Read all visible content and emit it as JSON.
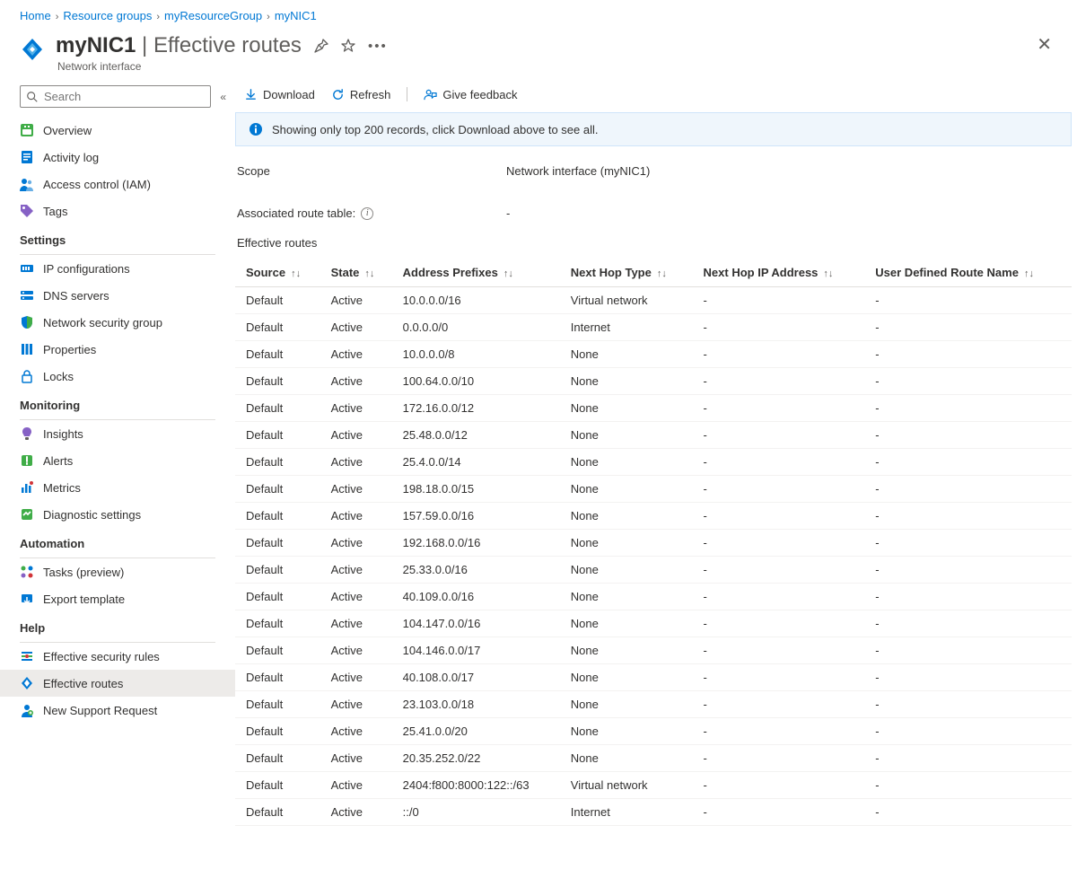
{
  "breadcrumb": [
    "Home",
    "Resource groups",
    "myResourceGroup",
    "myNIC1"
  ],
  "header": {
    "resource": "myNIC1",
    "page": "Effective routes",
    "subtitle": "Network interface"
  },
  "search": {
    "placeholder": "Search"
  },
  "sidebar": {
    "top": [
      {
        "id": "overview",
        "label": "Overview",
        "icon": "overview"
      },
      {
        "id": "activity",
        "label": "Activity log",
        "icon": "activity"
      },
      {
        "id": "iam",
        "label": "Access control (IAM)",
        "icon": "iam"
      },
      {
        "id": "tags",
        "label": "Tags",
        "icon": "tags"
      }
    ],
    "sections": [
      {
        "title": "Settings",
        "items": [
          {
            "id": "ipconfig",
            "label": "IP configurations",
            "icon": "ipconfig"
          },
          {
            "id": "dns",
            "label": "DNS servers",
            "icon": "dns"
          },
          {
            "id": "nsg",
            "label": "Network security group",
            "icon": "nsg"
          },
          {
            "id": "props",
            "label": "Properties",
            "icon": "props"
          },
          {
            "id": "locks",
            "label": "Locks",
            "icon": "locks"
          }
        ]
      },
      {
        "title": "Monitoring",
        "items": [
          {
            "id": "insights",
            "label": "Insights",
            "icon": "insights"
          },
          {
            "id": "alerts",
            "label": "Alerts",
            "icon": "alerts"
          },
          {
            "id": "metrics",
            "label": "Metrics",
            "icon": "metrics"
          },
          {
            "id": "diag",
            "label": "Diagnostic settings",
            "icon": "diag"
          }
        ]
      },
      {
        "title": "Automation",
        "items": [
          {
            "id": "tasks",
            "label": "Tasks (preview)",
            "icon": "tasks"
          },
          {
            "id": "export",
            "label": "Export template",
            "icon": "export"
          }
        ]
      },
      {
        "title": "Help",
        "items": [
          {
            "id": "effsec",
            "label": "Effective security rules",
            "icon": "effsec"
          },
          {
            "id": "effroutes",
            "label": "Effective routes",
            "icon": "effroutes",
            "selected": true
          },
          {
            "id": "support",
            "label": "New Support Request",
            "icon": "support"
          }
        ]
      }
    ]
  },
  "toolbar": {
    "download": "Download",
    "refresh": "Refresh",
    "feedback": "Give feedback"
  },
  "banner": "Showing only top 200 records, click Download above to see all.",
  "kv": {
    "scope_label": "Scope",
    "scope_value": "Network interface (myNIC1)",
    "assoc_label": "Associated route table:",
    "assoc_value": "-"
  },
  "table": {
    "title": "Effective routes",
    "columns": [
      "Source",
      "State",
      "Address Prefixes",
      "Next Hop Type",
      "Next Hop IP Address",
      "User Defined Route Name"
    ],
    "rows": [
      [
        "Default",
        "Active",
        "10.0.0.0/16",
        "Virtual network",
        "-",
        "-"
      ],
      [
        "Default",
        "Active",
        "0.0.0.0/0",
        "Internet",
        "-",
        "-"
      ],
      [
        "Default",
        "Active",
        "10.0.0.0/8",
        "None",
        "-",
        "-"
      ],
      [
        "Default",
        "Active",
        "100.64.0.0/10",
        "None",
        "-",
        "-"
      ],
      [
        "Default",
        "Active",
        "172.16.0.0/12",
        "None",
        "-",
        "-"
      ],
      [
        "Default",
        "Active",
        "25.48.0.0/12",
        "None",
        "-",
        "-"
      ],
      [
        "Default",
        "Active",
        "25.4.0.0/14",
        "None",
        "-",
        "-"
      ],
      [
        "Default",
        "Active",
        "198.18.0.0/15",
        "None",
        "-",
        "-"
      ],
      [
        "Default",
        "Active",
        "157.59.0.0/16",
        "None",
        "-",
        "-"
      ],
      [
        "Default",
        "Active",
        "192.168.0.0/16",
        "None",
        "-",
        "-"
      ],
      [
        "Default",
        "Active",
        "25.33.0.0/16",
        "None",
        "-",
        "-"
      ],
      [
        "Default",
        "Active",
        "40.109.0.0/16",
        "None",
        "-",
        "-"
      ],
      [
        "Default",
        "Active",
        "104.147.0.0/16",
        "None",
        "-",
        "-"
      ],
      [
        "Default",
        "Active",
        "104.146.0.0/17",
        "None",
        "-",
        "-"
      ],
      [
        "Default",
        "Active",
        "40.108.0.0/17",
        "None",
        "-",
        "-"
      ],
      [
        "Default",
        "Active",
        "23.103.0.0/18",
        "None",
        "-",
        "-"
      ],
      [
        "Default",
        "Active",
        "25.41.0.0/20",
        "None",
        "-",
        "-"
      ],
      [
        "Default",
        "Active",
        "20.35.252.0/22",
        "None",
        "-",
        "-"
      ],
      [
        "Default",
        "Active",
        "2404:f800:8000:122::/63",
        "Virtual network",
        "-",
        "-"
      ],
      [
        "Default",
        "Active",
        "::/0",
        "Internet",
        "-",
        "-"
      ]
    ]
  },
  "icons": {
    "overview": "<svg viewBox='0 0 16 16'><rect x='1' y='1' width='14' height='14' rx='2' fill='#40ad48'/><rect x='5' y='3' width='2' height='2' fill='#fff'/><rect x='9' y='3' width='2' height='2' fill='#fff'/><rect x='3' y='7' width='10' height='6' rx='1' fill='#fff'/></svg>",
    "activity": "<svg viewBox='0 0 16 16'><rect x='2' y='1' width='12' height='14' rx='1' fill='#0078d4'/><rect x='4' y='4' width='8' height='1.5' fill='#fff'/><rect x='4' y='7' width='8' height='1.5' fill='#fff'/><rect x='4' y='10' width='5' height='1.5' fill='#fff'/></svg>",
    "iam": "<svg viewBox='0 0 16 16'><circle cx='5' cy='5' r='3' fill='#0078d4'/><path d='M0 16 C0 11 4 10 5 10 C6 10 10 11 10 16 Z' fill='#0078d4'/><circle cx='11' cy='6' r='2.2' fill='#69afe5'/><path d='M7 16 C7 12 10 11.5 11 11.5 C12 11.5 15 12 15 16 Z' fill='#69afe5'/></svg>",
    "tags": "<svg viewBox='0 0 16 16'><path d='M1 1 L8 1 L15 8 L8 15 L1 8 Z' fill='#8661c5'/><circle cx='4.5' cy='4.5' r='1.5' fill='#fff'/></svg>",
    "ipconfig": "<svg viewBox='0 0 16 16'><rect x='1' y='4' width='14' height='8' rx='1' fill='#0078d4'/><rect x='3' y='6' width='2' height='4' fill='#fff'/><rect x='6' y='6' width='2' height='4' fill='#fff'/><rect x='9' y='6' width='2' height='4' fill='#fff'/></svg>",
    "dns": "<svg viewBox='0 0 16 16'><rect x='1' y='3' width='14' height='4' rx='1' fill='#0078d4'/><rect x='1' y='9' width='14' height='4' rx='1' fill='#0078d4'/><circle cx='4' cy='5' r='1' fill='#fff'/><circle cx='4' cy='11' r='1' fill='#fff'/></svg>",
    "nsg": "<svg viewBox='0 0 16 16'><path d='M8 1 L14 3 L14 8 C14 12 11 15 8 15 C5 15 2 12 2 8 L2 3 Z' fill='#0078d4'/><path d='M8 1 L14 3 L14 8 C14 12 11 15 8 15 Z' fill='#40ad48'/></svg>",
    "props": "<svg viewBox='0 0 16 16'><rect x='2' y='2' width='3' height='12' fill='#0078d4'/><rect x='6.5' y='2' width='3' height='12' fill='#0078d4'/><rect x='11' y='2' width='3' height='12' fill='#0078d4'/></svg>",
    "locks": "<svg viewBox='0 0 16 16'><rect x='3' y='7' width='10' height='8' rx='1' fill='none' stroke='#0078d4' stroke-width='1.5'/><path d='M5 7 L5 5 A3 3 0 0 1 11 5 L11 7' fill='none' stroke='#0078d4' stroke-width='1.5'/></svg>",
    "insights": "<svg viewBox='0 0 16 16'><path d='M8 1 C11 1 13 3 13 6 C13 8 11.5 9 11 11 L5 11 C4.5 9 3 8 3 6 C3 3 5 1 8 1 Z' fill='#8661c5'/><rect x='6' y='12' width='4' height='3' rx='1' fill='#605e5c'/></svg>",
    "alerts": "<svg viewBox='0 0 16 16'><rect x='2' y='2' width='12' height='12' rx='2' fill='#40ad48'/><path d='M8 4 L8 9 M8 11 L8 12' stroke='#fff' stroke-width='2' stroke-linecap='round'/></svg>",
    "metrics": "<svg viewBox='0 0 16 16'><rect x='2' y='8' width='2.5' height='6' fill='#0078d4'/><rect x='6' y='4' width='2.5' height='10' fill='#0078d4'/><rect x='10' y='6' width='2.5' height='8' fill='#0078d4'/><circle cx='13' cy='3' r='2' fill='#d13438'/></svg>",
    "diag": "<svg viewBox='0 0 16 16'><rect x='2' y='2' width='12' height='12' rx='2' fill='#40ad48'/><path d='M4 9 L7 6 L9 8 L12 5' stroke='#fff' stroke-width='1.8' fill='none'/></svg>",
    "tasks": "<svg viewBox='0 0 16 16'><circle cx='4' cy='4' r='2.5' fill='#40ad48'/><circle cx='12' cy='4' r='2.5' fill='#0078d4'/><circle cx='4' cy='12' r='2.5' fill='#8661c5'/><circle cx='12' cy='12' r='2.5' fill='#d13438'/></svg>",
    "export": "<svg viewBox='0 0 16 16'><rect x='2' y='3' width='12' height='9' rx='1' fill='#0078d4'/><path d='M8 6 L8 13 M5 10 L8 13 L11 10' stroke='#fff' stroke-width='1.5' fill='none'/></svg>",
    "effsec": "<svg viewBox='0 0 16 16'><path d='M2 8 L6 8 M10 8 L14 8' stroke='#40ad48' stroke-width='2'/><path d='M2 4 L14 4 M2 12 L14 12' stroke='#0078d4' stroke-width='2'/><circle cx='8' cy='8' r='2' fill='#d13438'/></svg>",
    "effroutes": "<svg viewBox='0 0 16 16'><path d='M8 1 L14 8 L8 15 L2 8 Z' fill='#0078d4'/><path d='M8 4 L11 8 L8 12 L5 8 Z' fill='#fff'/></svg>",
    "support": "<svg viewBox='0 0 16 16'><circle cx='8' cy='5' r='3' fill='#0078d4'/><path d='M2 16 C2 11 6 10 8 10 C10 10 14 11 14 16 Z' fill='#0078d4'/><circle cx='12' cy='11' r='3' fill='#40ad48'/><path d='M12 9.5 L12 12.5 M10.5 11 L13.5 11' stroke='#fff' stroke-width='1.2'/></svg>",
    "hdr": "<svg viewBox='0 0 28 28'><path d='M14 2 L25 14 L14 26 L3 14 Z' fill='#0078d4'/><path d='M14 7 L20 14 L14 21 L8 14 Z' fill='#50b0e8'/><path d='M14 11 L17 14 L14 17 L11 14 Z' fill='#fff'/></svg>"
  }
}
